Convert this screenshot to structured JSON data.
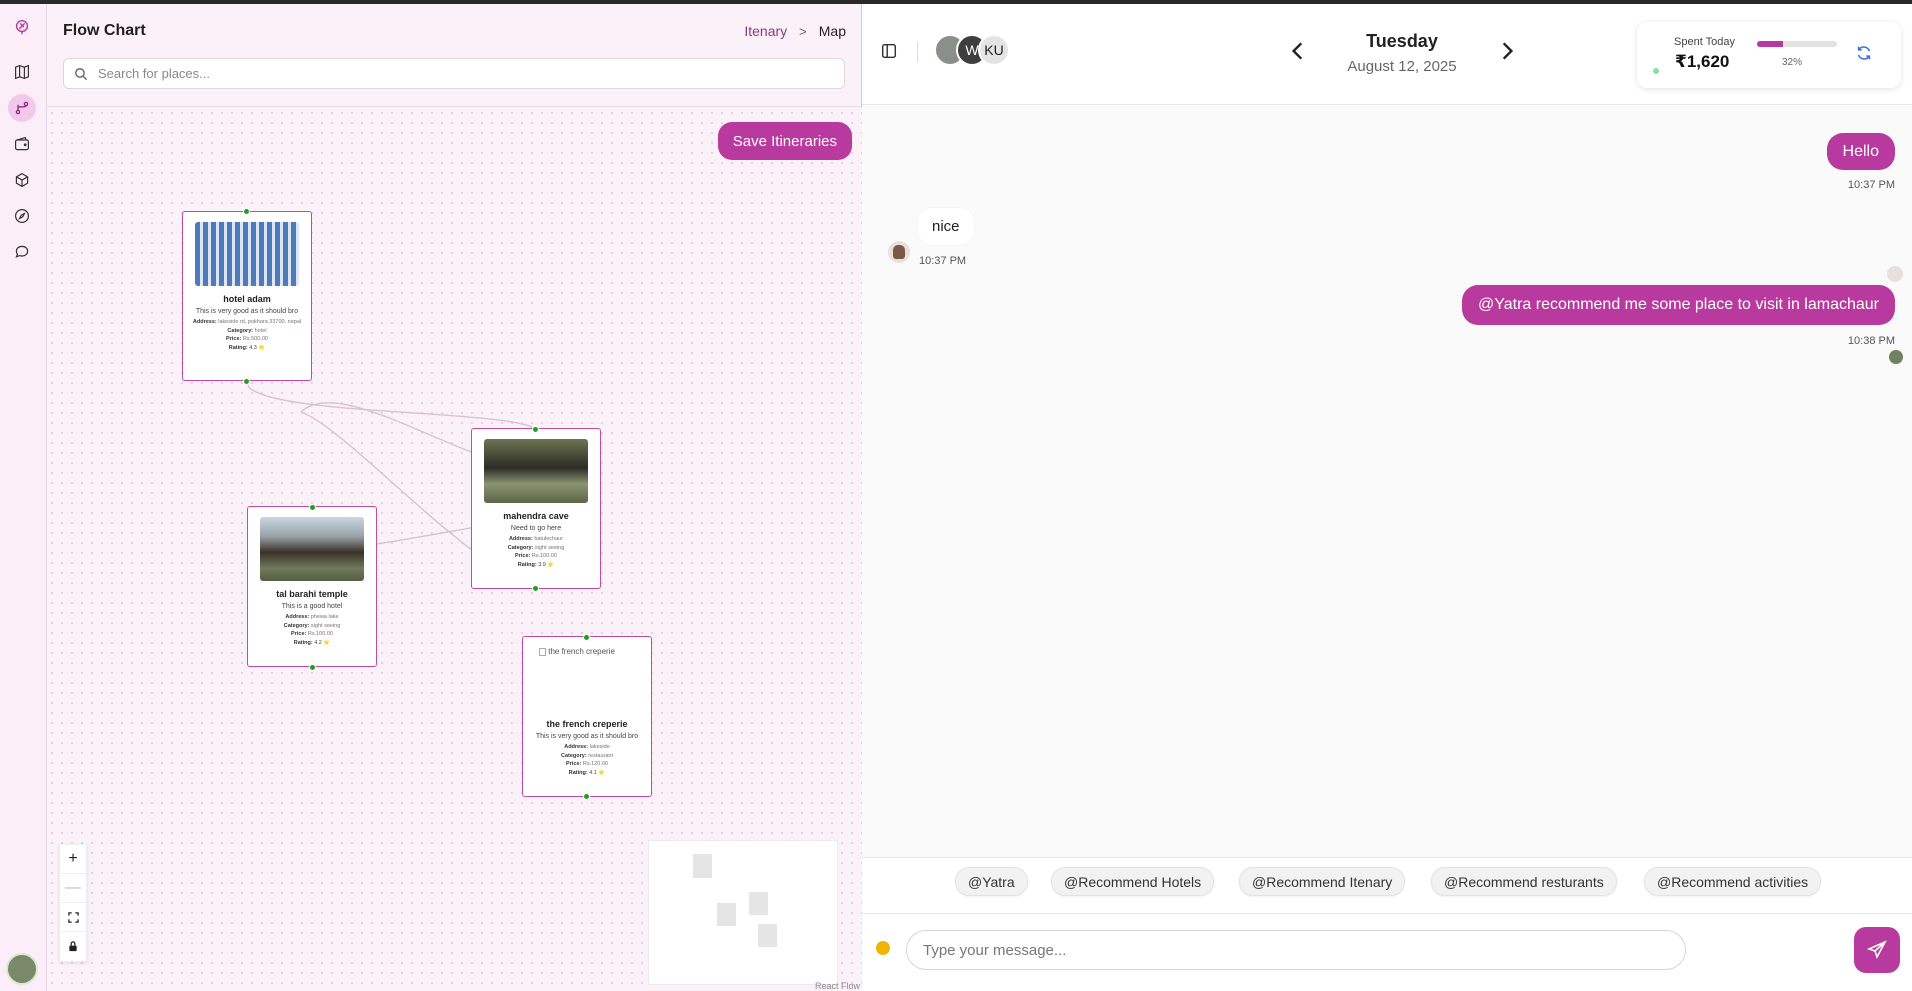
{
  "left_panel": {
    "title": "Flow Chart",
    "breadcrumb": [
      "Itenary",
      "Map"
    ],
    "search_placeholder": "Search for places...",
    "save_button": "Save Itineraries",
    "attribution": "React Flow"
  },
  "nodes": [
    {
      "title": "hotel adam",
      "desc": "This is very good as it should bro",
      "address_label": "Address:",
      "address": "lakeside rd, pokhara 33700, nepal",
      "category_label": "Category:",
      "category": "hotel",
      "price_label": "Price:",
      "price": "Rs.500.00",
      "rating_label": "Rating:",
      "rating": "4.3 ⭐"
    },
    {
      "title": "mahendra cave",
      "desc": "Need to go here",
      "address_label": "Address:",
      "address": "batulechaur",
      "category_label": "Category:",
      "category": "sight seeing",
      "price_label": "Price:",
      "price": "Rs.100.00",
      "rating_label": "Rating:",
      "rating": "3.9 ⭐"
    },
    {
      "title": "tal barahi temple",
      "desc": "This is a good hotel",
      "address_label": "Address:",
      "address": "phewa lake",
      "category_label": "Category:",
      "category": "sight seeing",
      "price_label": "Price:",
      "price": "Rs.100.00",
      "rating_label": "Rating:",
      "rating": "4.2 ⭐"
    },
    {
      "title": "the french creperie",
      "image_alt": "the french creperie",
      "desc": "This is very good as it should bro",
      "address_label": "Address:",
      "address": "lakeside",
      "category_label": "Category:",
      "category": "restaurant",
      "price_label": "Price:",
      "price": "Rs.120.00",
      "rating_label": "Rating:",
      "rating": "4.1 ⭐"
    }
  ],
  "header": {
    "avatars": [
      "",
      "W",
      "KU"
    ],
    "day": "Tuesday",
    "date": "August 12, 2025",
    "spent_label": "Spent Today",
    "spent_amount": "₹1,620",
    "spent_percent": "32%",
    "spent_fraction": 0.32
  },
  "messages": [
    {
      "side": "out",
      "text": "Hello",
      "time": "10:37 PM"
    },
    {
      "side": "in",
      "text": "nice",
      "time": "10:37 PM"
    },
    {
      "side": "out",
      "text": "@Yatra recommend me some place to visit in lamachaur",
      "time": "10:38 PM"
    }
  ],
  "suggestions": [
    "@Yatra",
    "@Recommend Hotels",
    "@Recommend Itenary",
    "@Recommend resturants",
    "@Recommend activities"
  ],
  "composer": {
    "placeholder": "Type your message..."
  },
  "colors": {
    "accent": "#b83a9e",
    "edge_handle": "#1f9d25",
    "status_dot": "#f0b400"
  }
}
